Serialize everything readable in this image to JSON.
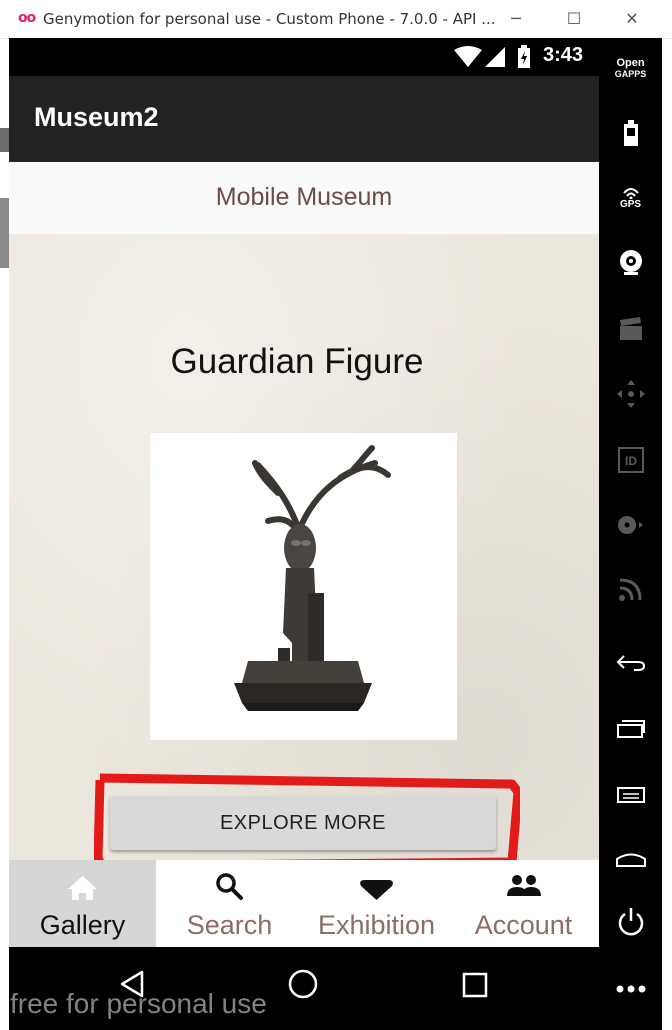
{
  "window": {
    "title": "Genymotion for personal use - Custom Phone - 7.0.0 - API ...",
    "logo": "oo",
    "minimize": "─",
    "maximize": "☐",
    "close": "✕"
  },
  "status_bar": {
    "time": "3:43"
  },
  "action_bar": {
    "title": "Museum2"
  },
  "header": {
    "title": "Mobile Museum"
  },
  "artwork": {
    "title": "Guardian Figure",
    "image": "guardian-figure-sculpture"
  },
  "explore_button": {
    "label": "EXPLORE MORE"
  },
  "tabs": [
    {
      "label": "Gallery",
      "icon": "home-icon",
      "active": true
    },
    {
      "label": "Search",
      "icon": "search-icon",
      "active": false
    },
    {
      "label": "Exhibition",
      "icon": "heart-icon",
      "active": false
    },
    {
      "label": "Account",
      "icon": "people-icon",
      "active": false
    }
  ],
  "watermark": "free for personal use",
  "sidebar": {
    "gapps_line1": "Open",
    "gapps_line2": "GAPPS",
    "gps": "GPS"
  },
  "colors": {
    "accent_text": "#6d4c41",
    "highlight": "#e31a1a",
    "action_bar": "#222222"
  }
}
